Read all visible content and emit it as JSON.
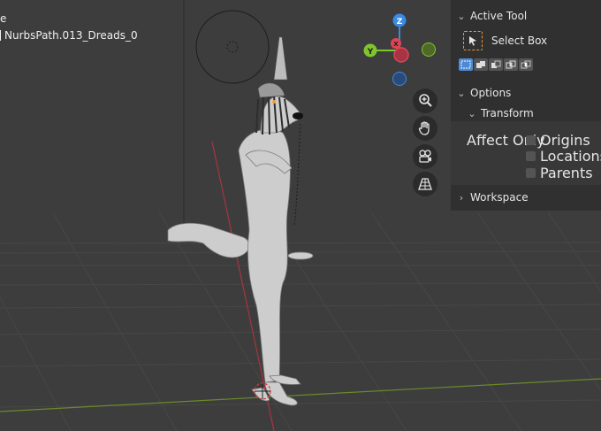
{
  "viewport": {
    "header_fragment": "e",
    "object_name": "NurbsPath.013_Dreads_0",
    "axis_labels": {
      "z": "Z",
      "y": "Y",
      "x": "X"
    },
    "axis_colors": {
      "x": "#e04454",
      "y": "#7fc52e",
      "z": "#3b8ae6"
    },
    "nav_icons": [
      "zoom-icon",
      "hand-pan-icon",
      "camera-icon",
      "perspective-grid-icon"
    ]
  },
  "sidebar": {
    "active_tool": {
      "header": "Active Tool",
      "tool_name": "Select Box",
      "modes": [
        "mode-new",
        "mode-extend",
        "mode-subtract",
        "mode-invert",
        "mode-intersect"
      ]
    },
    "options": {
      "header": "Options",
      "transform": {
        "header": "Transform",
        "affect_only_label": "Affect Only",
        "checkboxes": [
          {
            "label": "Origins",
            "checked": false
          },
          {
            "label": "Locations",
            "checked": false
          },
          {
            "label": "Parents",
            "checked": false
          }
        ]
      }
    },
    "workspace": {
      "header": "Workspace"
    }
  },
  "colors": {
    "panel_bg": "#303030",
    "viewport_bg": "#3d3d3d",
    "accent": "#4d8ad6",
    "tool_orange": "#e59b3a"
  }
}
